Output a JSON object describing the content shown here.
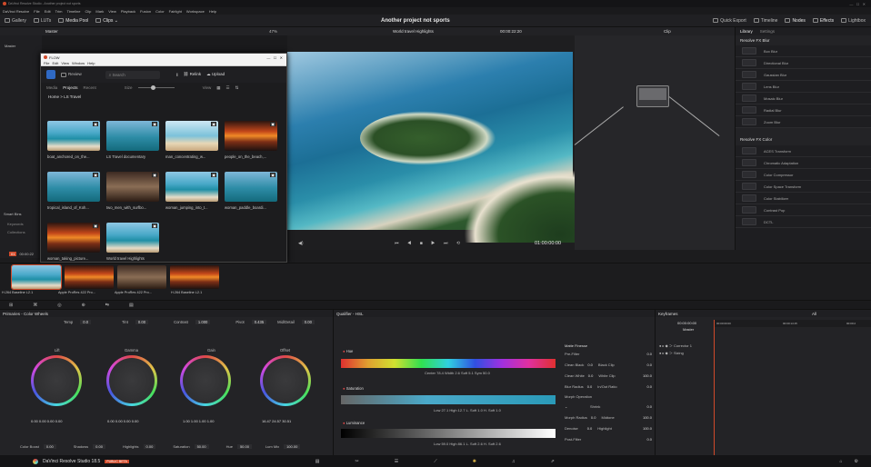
{
  "window": {
    "title": "DaVinci Resolve Studio - Another project not sports",
    "menus": [
      "DaVinci Resolve",
      "File",
      "Edit",
      "Trim",
      "Timeline",
      "Clip",
      "Mark",
      "View",
      "Playback",
      "Fusion",
      "Color",
      "Fairlight",
      "Workspace",
      "Help"
    ]
  },
  "project_title": "Another project not sports",
  "toolbar": {
    "gallery": "Gallery",
    "luts": "LUTs",
    "media_pool": "Media Pool",
    "clips": "Clips",
    "quick_export": "Quick Export",
    "timeline": "Timeline",
    "nodes": "Nodes",
    "effects": "Effects",
    "lightbox": "Lightbox"
  },
  "viewer": {
    "zoom": "47%",
    "timeline_name": "World travel Highlights",
    "timecode_top": "00:00:22:20",
    "clip": "Clip",
    "timecode": "01:00:00:00"
  },
  "media": {
    "master": "Master",
    "smart_bins": "Smart Bins",
    "keywords": "Keywords",
    "collections": "Collections",
    "timecode": "00:00:22"
  },
  "flow": {
    "title": "FLOW",
    "menus": [
      "File",
      "Edit",
      "View",
      "Window",
      "Help"
    ],
    "review": "Review",
    "search_placeholder": "Search",
    "relink": "Relink",
    "upload": "Upload",
    "tabs": [
      "Media",
      "Projects",
      "Recent"
    ],
    "size_label": "Size",
    "view_label": "View",
    "breadcrumb": "Home  >  LS Travel",
    "items": [
      "boat_anchored_on_the...",
      "LS Travel documentary",
      "man_concentrating_w...",
      "people_on_the_beach,...",
      "tropical_island_of_Koh...",
      "two_men_with_surfbo...",
      "woman_jumping_into_t...",
      "woman_paddle_boardi...",
      "woman_taking_picture...",
      "World travel Highlights"
    ]
  },
  "clips_strip": [
    "H.264 Baseline L2.1",
    "Apple ProRes 422 Pro...",
    "Apple ProRes 422 Pro...",
    "H.264 Baseline L2.1"
  ],
  "library": {
    "tab_library": "Library",
    "tab_settings": "Settings",
    "blur_header": "Resolve FX Blur",
    "blur_items": [
      "Box Blur",
      "Directional Blur",
      "Gaussian Blur",
      "Lens Blur",
      "Mosaic Blur",
      "Radial Blur",
      "Zoom Blur"
    ],
    "color_header": "Resolve FX Color",
    "color_items": [
      "ACES Transform",
      "Chromatic Adaptation",
      "Color Compressor",
      "Color Space Transform",
      "Color Stabilizer",
      "Contrast Pop",
      "DCTL"
    ]
  },
  "wheels": {
    "header": "Primaries - Color Wheels",
    "temp_label": "Temp",
    "temp": "0.0",
    "tint_label": "Tint",
    "tint": "0.00",
    "contrast_label": "Contrast",
    "contrast": "1.000",
    "pivot_label": "Pivot",
    "pivot": "0.435",
    "md_label": "Mid/Detail",
    "md": "0.00",
    "lift": "Lift",
    "gamma": "Gamma",
    "gain": "Gain",
    "offset": "Offset",
    "lift_vals": "0.00  0.00  0.00  0.00",
    "gamma_vals": "0.00  0.00  0.00  0.00",
    "gain_vals": "1.00  1.00  1.00  1.00",
    "offset_vals": "16.47  24.57  30.51",
    "color_boost_label": "Color Boost",
    "color_boost": "0.00",
    "shadows_label": "Shadows",
    "shadows": "0.00",
    "highlights_label": "Highlights",
    "highlights": "0.00",
    "saturation_label": "Saturation",
    "saturation": "50.00",
    "hue_label": "Hue",
    "hue": "50.00",
    "lum_mix_label": "Lum Mix",
    "lum_mix": "100.00"
  },
  "qualifier": {
    "header": "Qualifier - HSL",
    "hue": "Hue",
    "saturation": "Saturation",
    "luminance": "Luminance",
    "hue_vals": "Center  78.4   Width  2.6    Soft  5.1    Sym  50.0",
    "sat_vals": "Low  27.1    High  12.7    L. Soft  1.0    H. Soft  1.0",
    "lum_vals": "Low  59.0    High  86.1    L. Soft  2.6    H. Soft  2.6",
    "matte_header": "Matte Finesse",
    "pre_filter": "Pre-Filter",
    "pre_filter_val": "0.0",
    "rows": [
      [
        "Clean Black",
        "0.0",
        "Black Clip",
        "0.0"
      ],
      [
        "Clean White",
        "0.0",
        "White Clip",
        "100.0"
      ],
      [
        "Blur Radius",
        "0.0",
        "In/Out Ratio",
        "0.0"
      ]
    ],
    "morph_op": "Morph Operation",
    "shrink": "Shrink",
    "shrink_val": "0.0",
    "morph_radius": "Morph Radius",
    "morph_radius_val": "0.0",
    "midtone": "Midtone",
    "midtone_val": "100.0",
    "denoise": "Denoise",
    "denoise_val": "0.0",
    "highlight": "Highlight",
    "highlight_val": "100.0",
    "post_filter": "Post-Filter",
    "post_filter_val": "0.0"
  },
  "keyframes": {
    "header": "Keyframes",
    "filter": "All",
    "timecode": "00:00:00:00",
    "master": "Master",
    "tracks": [
      "Corrector 1",
      "Sizing"
    ],
    "ruler": [
      "00:00:00:00",
      "00:00:14:15",
      "00:00:2"
    ]
  },
  "status": {
    "app": "DaVinci Resolve Studio 18.5",
    "badge": "PUBLIC BETA"
  }
}
